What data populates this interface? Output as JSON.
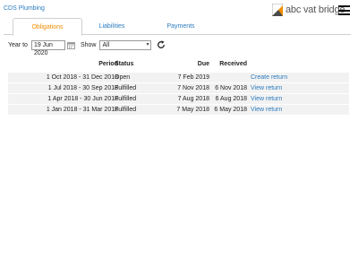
{
  "header": {
    "company": "CDS Plumbing",
    "brand": "abc vat bridge",
    "brand_color": "#f08c00",
    "link_color": "#2b7bbf",
    "menu_icon": "hamburger-menu-icon"
  },
  "tabs": [
    {
      "label": "Obligations",
      "active": true
    },
    {
      "label": "Liabilities",
      "active": false
    },
    {
      "label": "Payments",
      "active": false
    }
  ],
  "filters": {
    "year_label": "Year to",
    "year_value": "19 Jun 2020",
    "show_label": "Show",
    "show_value": "All",
    "calendar_icon": "calendar-icon",
    "refresh_icon": "refresh-icon"
  },
  "table": {
    "columns": {
      "period": "Period",
      "status": "Status",
      "due": "Due",
      "received": "Received"
    },
    "rows": [
      {
        "period": "1 Oct 2018 - 31 Dec 2018",
        "status": "Open",
        "due": "7 Feb 2019",
        "received": "",
        "action": "Create return"
      },
      {
        "period": "1 Jul 2018 - 30 Sep 2018",
        "status": "Fulfilled",
        "due": "7 Nov 2018",
        "received": "6 Nov 2018",
        "action": "View return"
      },
      {
        "period": "1 Apr 2018 - 30 Jun 2018",
        "status": "Fulfilled",
        "due": "7 Aug 2018",
        "received": "6 Aug 2018",
        "action": "View return"
      },
      {
        "period": "1 Jan 2018 - 31 Mar 2018",
        "status": "Fulfilled",
        "due": "7 May 2018",
        "received": "6 May 2018",
        "action": "View return"
      }
    ]
  }
}
